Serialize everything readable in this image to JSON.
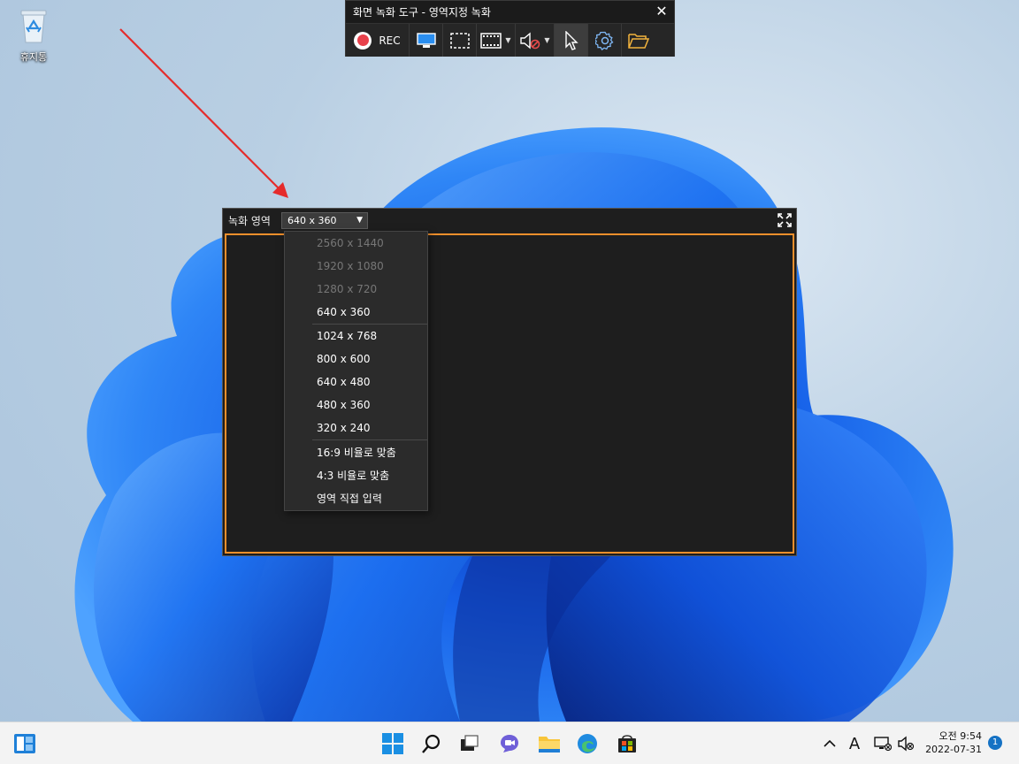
{
  "desktop": {
    "recycle_bin_label": "휴지통"
  },
  "toolbar": {
    "title": "화면 녹화 도구 - 영역지정 녹화",
    "close_glyph": "✕",
    "rec_label": "REC",
    "buttons": [
      "record-button",
      "monitor-icon",
      "region-select-icon",
      "film-icon",
      "audio-mute-icon",
      "cursor-icon",
      "gear-icon",
      "folder-open-icon"
    ]
  },
  "region": {
    "label": "녹화 영역",
    "selected_resolution": "640 x 360"
  },
  "dropdown": {
    "group1": [
      {
        "label": "2560 x 1440",
        "disabled": true
      },
      {
        "label": "1920 x 1080",
        "disabled": true
      },
      {
        "label": "1280 x 720",
        "disabled": true
      },
      {
        "label": "640 x 360",
        "disabled": false
      }
    ],
    "group2": [
      {
        "label": "1024 x 768"
      },
      {
        "label": "800 x 600"
      },
      {
        "label": "640 x 480"
      },
      {
        "label": "480 x 360"
      },
      {
        "label": "320 x 240"
      }
    ],
    "group3": [
      {
        "label": "16:9 비율로 맞춤"
      },
      {
        "label": "4:3 비율로 맞춤"
      },
      {
        "label": "영역 직접 입력"
      }
    ]
  },
  "taskbar": {
    "time_period": "오전",
    "time": "9:54",
    "date": "2022-07-31",
    "ime_indicator": "A",
    "notification_count": "1",
    "accent": "#0067c0"
  }
}
